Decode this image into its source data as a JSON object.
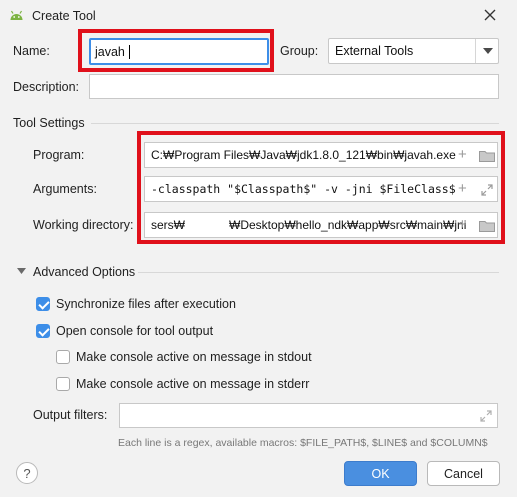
{
  "window": {
    "title": "Create Tool",
    "app_icon": "android-icon",
    "close_icon": "close-icon"
  },
  "form": {
    "name_label": "Name:",
    "name_value": "javah",
    "group_label": "Group:",
    "group_value": "External Tools",
    "description_label": "Description:",
    "description_value": ""
  },
  "tool_settings": {
    "heading": "Tool Settings",
    "program_label": "Program:",
    "program_value": "C:₩Program Files₩Java₩jdk1.8.0_121₩bin₩javah.exe",
    "arguments_label": "Arguments:",
    "arguments_value": "-classpath \"$Classpath$\" -v -jni $FileClass$",
    "working_dir_label": "Working directory:",
    "working_dir_value_start": "sers₩",
    "working_dir_value_end": "₩Desktop₩hello_ndk₩app₩src₩main₩jni"
  },
  "advanced": {
    "heading": "Advanced Options",
    "sync_label": "Synchronize files after execution",
    "sync_checked": true,
    "console_label": "Open console for tool output",
    "console_checked": true,
    "stdout_label": "Make console active on message in stdout",
    "stdout_checked": false,
    "stderr_label": "Make console active on message in stderr",
    "stderr_checked": false,
    "output_filters_label": "Output filters:",
    "output_filters_value": "",
    "hint": "Each line is a regex, available macros: $FILE_PATH$, $LINE$ and $COLUMN$"
  },
  "footer": {
    "help_label": "?",
    "ok_label": "OK",
    "cancel_label": "Cancel"
  },
  "colors": {
    "highlight": "#e0101b",
    "accent": "#3d8ee8"
  }
}
